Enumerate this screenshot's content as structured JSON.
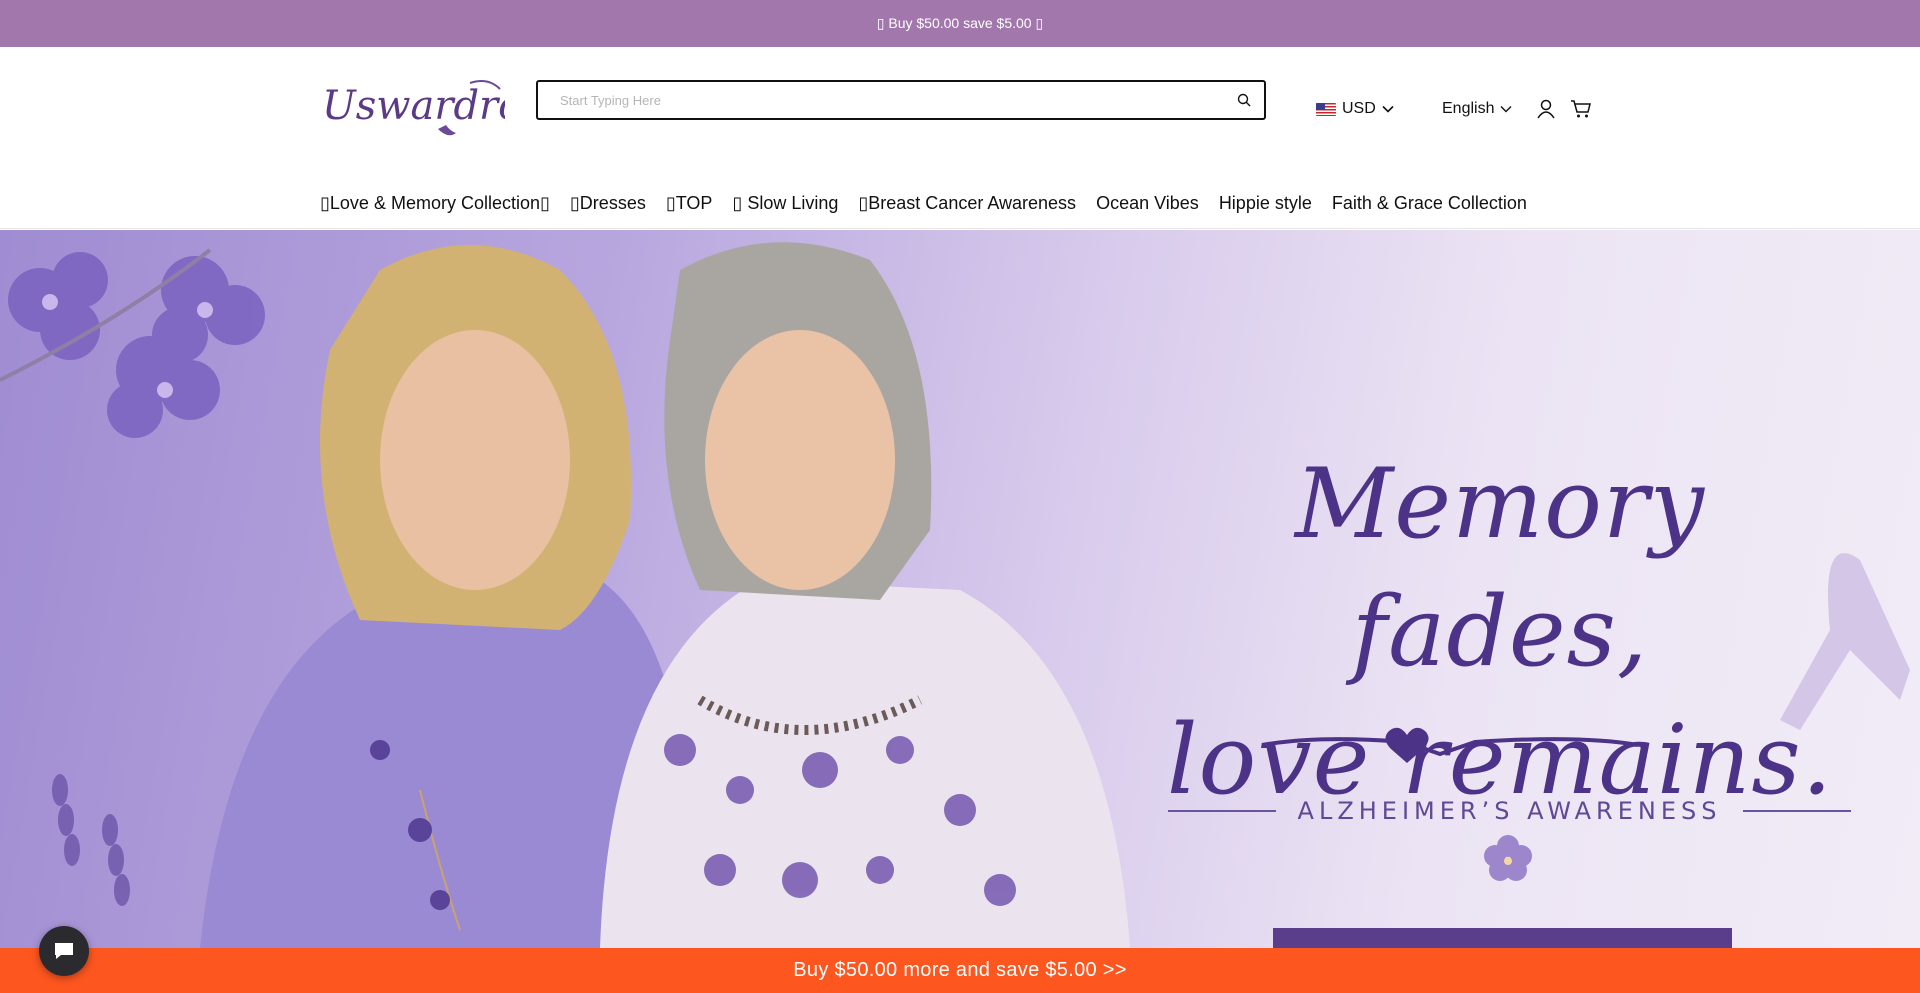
{
  "announcement": {
    "text": "▯ Buy $50.00 save $5.00 ▯"
  },
  "header": {
    "logo_text": "Uswardrobe",
    "search": {
      "placeholder": "Start Typing Here",
      "value": ""
    },
    "currency": {
      "label": "USD",
      "flag": "us-flag-icon"
    },
    "language": {
      "label": "English"
    },
    "icons": {
      "account": "user-icon",
      "cart": "cart-icon",
      "search": "search-icon"
    }
  },
  "nav": {
    "items": [
      {
        "label": "▯Love & Memory Collection▯"
      },
      {
        "label": "▯Dresses"
      },
      {
        "label": "▯TOP"
      },
      {
        "label": "▯ Slow Living"
      },
      {
        "label": "▯Breast Cancer Awareness"
      },
      {
        "label": "Ocean Vibes"
      },
      {
        "label": "Hippie style"
      },
      {
        "label": "Faith & Grace Collection"
      }
    ]
  },
  "hero": {
    "headline_line1": "Memory fades,",
    "headline_line2": "love remains.",
    "subline": "ALZHEIMER’S AWARENESS"
  },
  "promo_bar": {
    "text": "Buy $50.00 more and save $5.00  >>"
  },
  "colors": {
    "announcement_bg": "#a277ac",
    "promo_bg": "#fd561f",
    "hero_text": "#4d3388",
    "chat_bg": "#2b2b2f"
  }
}
